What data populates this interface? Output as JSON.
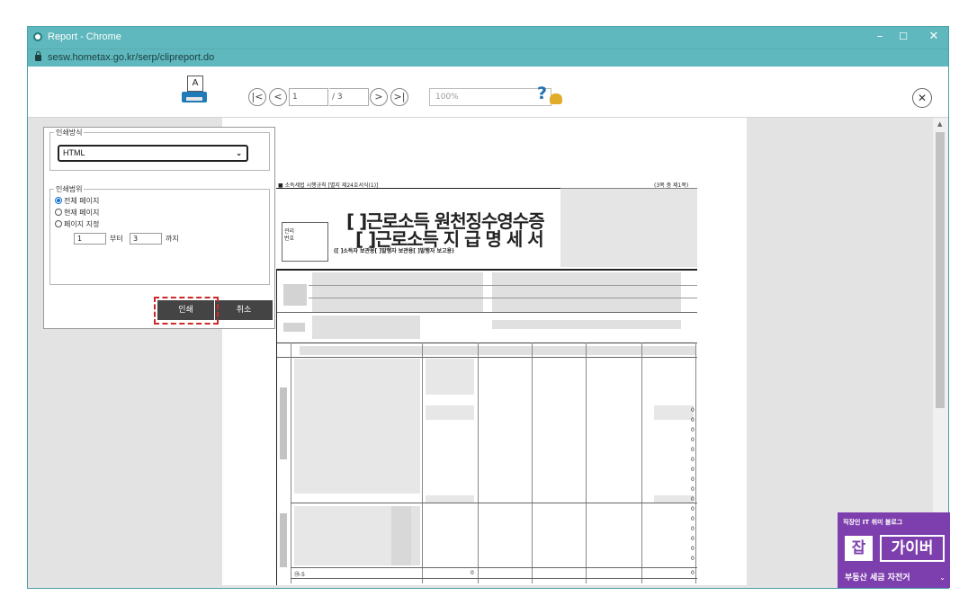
{
  "window": {
    "title": "Report - Chrome",
    "url": "sesw.hometax.go.kr/serp/clipreport.do",
    "minimize": "–",
    "maximize": "☐",
    "close": "✕"
  },
  "toolbar": {
    "printer_letter": "A",
    "first": "|<",
    "prev": "<",
    "page_current": "1",
    "page_total": "/ 3",
    "next": ">",
    "last": ">|",
    "zoom": "100%",
    "help": "?",
    "close": "✕"
  },
  "dialog": {
    "method_legend": "인쇄방식",
    "method_value": "HTML",
    "range_legend": "인쇄범위",
    "options": [
      {
        "label": "전체 페이지",
        "selected": true
      },
      {
        "label": "현재 페이지",
        "selected": false
      },
      {
        "label": "페이지 지정",
        "selected": false
      }
    ],
    "from_value": "1",
    "from_label": "부터",
    "to_value": "3",
    "to_label": "까지",
    "print_button": "인쇄",
    "cancel_button": "취소"
  },
  "document": {
    "rule_ref": "■ 소득세법 시행규칙 [별지 제24호서식(1)]",
    "page_note": "(3쪽 중 제1쪽)",
    "mgmt_label_1": "관리",
    "mgmt_label_2": "번호",
    "title_line1": "[ ]근로소득 원천징수영수증",
    "title_line2": "[ ]근로소득 지 급 명 세 서",
    "subtitle": "([   ]소득자 보관용[    ]발행자 보관용[    ]발행자 보고용)",
    "bottom_row_label": "⑲-5",
    "bottom_row_value_1": "0",
    "bottom_row_value_2": "0",
    "zero": "0"
  },
  "badge": {
    "top": "직장인 IT 취미 블로그",
    "jab": "잡",
    "name": "가이버",
    "bottom": "부동산 세금 자전거"
  },
  "colors": {
    "titlebar": "#5fb8bd",
    "badge": "#7e3fae",
    "highlight": "#d02828"
  }
}
